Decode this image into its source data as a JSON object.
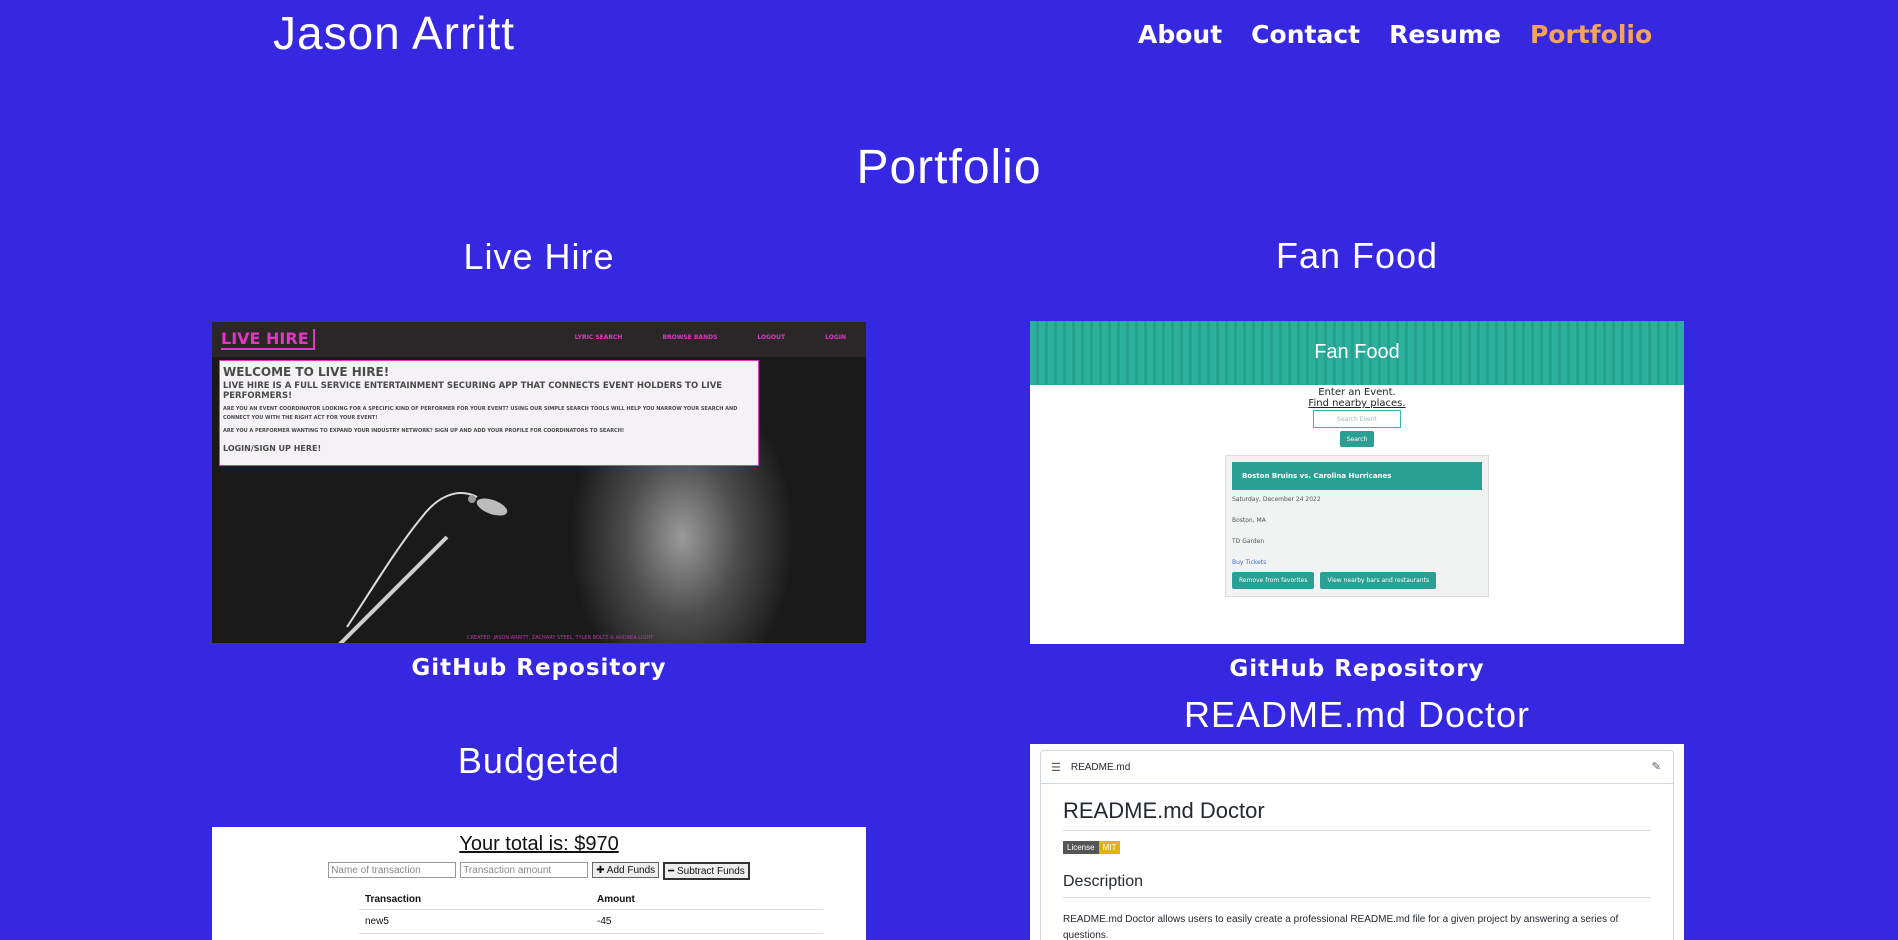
{
  "header": {
    "site_title": "Jason Arritt",
    "nav": [
      "About",
      "Contact",
      "Resume",
      "Portfolio"
    ],
    "active_nav": "Portfolio",
    "active_color": "#f4a35a"
  },
  "page_heading": "Portfolio",
  "colors": {
    "background": "#3627e0"
  },
  "projects": [
    {
      "title": "Live Hire",
      "repo_link": "GitHub Repository",
      "preview": {
        "logo": "LIVE HIRE",
        "nav": [
          "LYRIC SEARCH",
          "BROWSE BANDS",
          "LOGOUT",
          "LOGIN"
        ],
        "heading": "WELCOME TO LIVE HIRE!",
        "subheading": "LIVE HIRE IS A FULL SERVICE ENTERTAINMENT SECURING APP THAT CONNECTS EVENT HOLDERS TO LIVE PERFORMERS!",
        "para1": "ARE YOU AN EVENT COORDINATOR LOOKING FOR A SPECIFIC KIND OF PERFORMER FOR YOUR EVENT? USING OUR SIMPLE SEARCH TOOLS WILL HELP YOU NARROW YOUR SEARCH AND CONNECT YOU WITH THE RIGHT ACT FOR YOUR EVENT!",
        "para2": "ARE YOU A PERFORMER WANTING TO EXPAND YOUR INDUSTRY NETWORK? SIGN UP AND ADD YOUR PROFILE FOR COORDINATORS TO SEARCH!",
        "cta": "LOGIN/SIGN UP HERE!",
        "footer": "CREATED: JASON ARRITT, ZACHARY STEEL, TYLER BOLTZ & ANDREA LIGHT"
      }
    },
    {
      "title": "Fan Food",
      "repo_link": "GitHub Repository",
      "preview": {
        "banner": "Fan Food",
        "enter": "Enter an Event.",
        "find": "Find nearby places.",
        "search_placeholder": "Search Event",
        "search_button": "Search",
        "event_name": "Boston Bruins vs. Carolina Hurricanes",
        "event_date": "Saturday, December 24 2022",
        "event_city": "Boston, MA",
        "event_venue": "TD Garden",
        "buy": "Buy Tickets",
        "btn_remove": "Remove from favorites",
        "btn_nearby": "View nearby bars and restaurants"
      }
    },
    {
      "title": "Budgeted",
      "preview": {
        "total": "Your total is: $970",
        "name_placeholder": "Name of transaction",
        "amount_placeholder": "Transaction amount",
        "add": "✚ Add Funds",
        "subtract": "━ Subtract Funds",
        "col1": "Transaction",
        "col2": "Amount",
        "row1_name": "new5",
        "row1_amount": "-45"
      }
    },
    {
      "title": "README.md Doctor",
      "preview": {
        "file": "README.md",
        "h1": "README.md Doctor",
        "badge_left": "License",
        "badge_right": "MIT",
        "h2": "Description",
        "desc": "README.md Doctor allows users to easily create a professional README.md file for a given project by answering a series of questions."
      }
    }
  ]
}
